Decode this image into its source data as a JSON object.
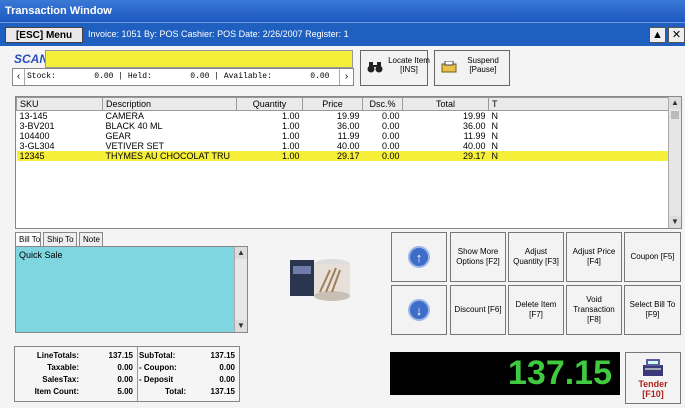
{
  "window": {
    "title": "Transaction Window",
    "esc_label": "[ESC] Menu",
    "info": "Invoice: 1051  By: POS  Cashier: POS  Date:  2/26/2007  Register: 1",
    "up_glyph": "▲",
    "close_glyph": "✕"
  },
  "scan": {
    "label": "SCAN",
    "value": "",
    "stock_text": "Stock:        0.00 | Held:        0.00 | Available:        0.00"
  },
  "buttons": {
    "locate": "Locate Item [INS]",
    "suspend": "Suspend [Pause]"
  },
  "grid": {
    "columns": [
      "SKU",
      "Description",
      "Quantity",
      "Price",
      "Dsc.%",
      "Total",
      "T"
    ],
    "rows": [
      [
        "13-145",
        "CAMERA",
        "1.00",
        "19.99",
        "0.00",
        "19.99",
        "N"
      ],
      [
        "3-BV201",
        "BLACK 40 ML",
        "1.00",
        "36.00",
        "0.00",
        "36.00",
        "N"
      ],
      [
        "104400",
        "GEAR",
        "1.00",
        "11.99",
        "0.00",
        "11.99",
        "N"
      ],
      [
        "3-GL304",
        "VETIVER SET",
        "1.00",
        "40.00",
        "0.00",
        "40.00",
        "N"
      ],
      [
        "12345",
        "THYMES AU CHOCOLAT TRU",
        "1.00",
        "29.17",
        "0.00",
        "29.17",
        "N"
      ]
    ],
    "selected_row": 4,
    "highlight_color": "#f5ef3a"
  },
  "tabs": [
    "Bill To",
    "Ship To",
    "Note"
  ],
  "notes": {
    "text": "Quick Sale"
  },
  "action_buttons": {
    "show_more": "Show More Options [F2]",
    "adjust_qty": "Adjust Quantity [F3]",
    "adjust_price": "Adjust Price [F4]",
    "coupon": "Coupon [F5]",
    "discount": "Discount [F6]",
    "delete_item": "Delete Item [F7]",
    "void": "Void Transaction [F8]",
    "select_bill": "Select Bill To [F9]"
  },
  "totals": {
    "line_totals_label": "LineTotals:",
    "line_totals": "137.15",
    "taxable_label": "Taxable:",
    "taxable": "0.00",
    "sales_tax_label": "SalesTax:",
    "sales_tax": "0.00",
    "item_count_label": "Item Count:",
    "item_count": "5.00",
    "subtotal_label": "SubTotal:",
    "subtotal": "137.15",
    "coupon_label": "- Coupon:",
    "coupon": "0.00",
    "deposit_label": "- Deposit",
    "deposit": "0.00",
    "total_label": "Total:",
    "total": "137.15"
  },
  "display": {
    "amount": "137.15",
    "color": "#3fca3f"
  },
  "tender": {
    "label": "Tender",
    "key": "[F10]"
  }
}
